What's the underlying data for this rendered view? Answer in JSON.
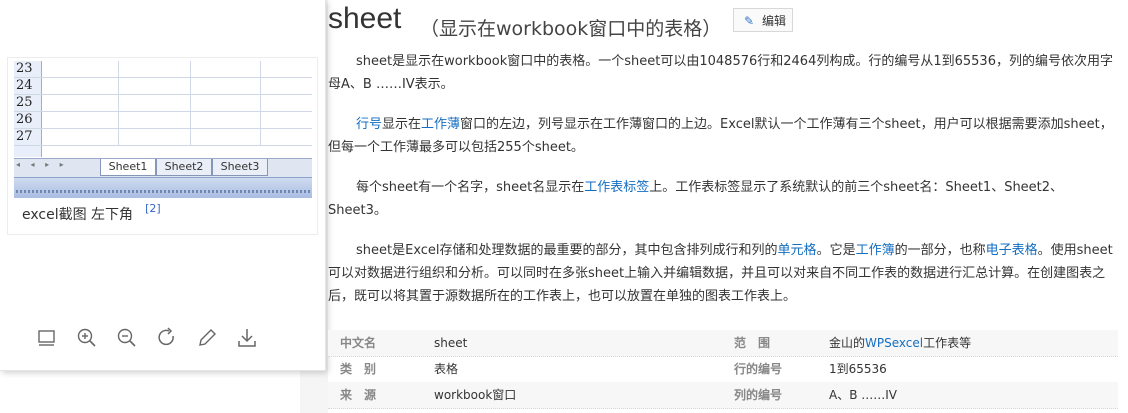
{
  "figure": {
    "rows": [
      "23",
      "24",
      "25",
      "26",
      "27"
    ],
    "nav_arrows": "◂ ◂ ▸ ▸",
    "tabs": [
      "Sheet1",
      "Sheet2",
      "Sheet3"
    ],
    "caption": "excel截图 左下角",
    "citation": "[2]"
  },
  "toolbar": {
    "icons": [
      "thumbnail-icon",
      "zoom-in-icon",
      "zoom-out-icon",
      "rotate-icon",
      "edit-icon",
      "download-icon"
    ]
  },
  "header": {
    "title": "sheet",
    "subtitle": "（显示在workbook窗口中的表格）",
    "edit_label": "编辑",
    "edit_icon": "✎"
  },
  "paragraphs": {
    "p1": "sheet是显示在workbook窗口中的表格。一个sheet可以由1048576行和2464列构成。行的编号从1到65536，列的编号依次用字母A、B ……IV表示。",
    "p2": [
      {
        "t": "行号",
        "link": true
      },
      {
        "t": "显示在",
        "link": false
      },
      {
        "t": "工作薄",
        "link": true
      },
      {
        "t": "窗口的左边，列号显示在工作薄窗口的上边。Excel默认一个工作薄有三个sheet，用户可以根据需要添加sheet，但每一个工作薄最多可以包括255个sheet。",
        "link": false
      }
    ],
    "p3": [
      {
        "t": "每个sheet有一个名字，sheet名显示在",
        "link": false
      },
      {
        "t": "工作表标签",
        "link": true
      },
      {
        "t": "上。工作表标签显示了系统默认的前三个sheet名：Sheet1、Sheet2、Sheet3。",
        "link": false
      }
    ],
    "p4": [
      {
        "t": "sheet是Excel存储和处理数据的最重要的部分，其中包含排列成行和列的",
        "link": false
      },
      {
        "t": "单元格",
        "link": true
      },
      {
        "t": "。它是",
        "link": false
      },
      {
        "t": "工作簿",
        "link": true
      },
      {
        "t": "的一部分，也称",
        "link": false
      },
      {
        "t": "电子表格",
        "link": true
      },
      {
        "t": "。使用sheet可以对数据进行组织和分析。可以同时在多张sheet上输入并编辑数据，并且可以对来自不同工作表的数据进行汇总计算。在创建图表之后，既可以将其置于源数据所在的工作表上，也可以放置在单独的图表工作表上。",
        "link": false
      }
    ]
  },
  "info_table": {
    "rows": [
      {
        "l1": "中文名",
        "v1": "sheet",
        "l2": "范　围",
        "v2_pre": "金山的",
        "v2_link": "WPSexcel",
        "v2_post": "工作表等"
      },
      {
        "l1": "类　别",
        "v1": "表格",
        "l2": "行的编号",
        "v2_pre": "1到65536",
        "v2_link": "",
        "v2_post": ""
      },
      {
        "l1": "来　源",
        "v1": "workbook窗口",
        "l2": "列的编号",
        "v2_pre": "A、B ……IV",
        "v2_link": "",
        "v2_post": ""
      }
    ]
  },
  "colors": {
    "link": "#136ec2",
    "label": "#888888"
  }
}
